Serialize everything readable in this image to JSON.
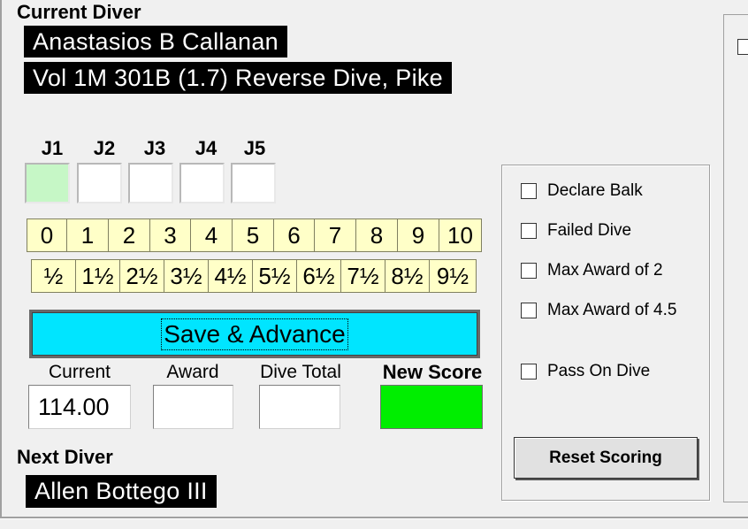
{
  "current_diver": {
    "label": "Current Diver",
    "name": "Anastasios B Callanan",
    "dive": "Vol 1M 301B (1.7) Reverse Dive, Pike"
  },
  "judges": {
    "labels": [
      "J1",
      "J2",
      "J3",
      "J4",
      "J5"
    ],
    "active_index": 0
  },
  "scores": {
    "whole": [
      "0",
      "1",
      "2",
      "3",
      "4",
      "5",
      "6",
      "7",
      "8",
      "9",
      "10"
    ],
    "half": [
      "½",
      "1½",
      "2½",
      "3½",
      "4½",
      "5½",
      "6½",
      "7½",
      "8½",
      "9½"
    ]
  },
  "save_button": {
    "label": "Save & Advance",
    "color": "#00e5ff"
  },
  "fields": {
    "current": {
      "label": "Current",
      "value": "114.00"
    },
    "award": {
      "label": "Award",
      "value": ""
    },
    "dive_total": {
      "label": "Dive Total",
      "value": ""
    },
    "new_score": {
      "label": "New Score",
      "value": "",
      "color": "#00ee00"
    }
  },
  "options": [
    {
      "label": "Declare Balk"
    },
    {
      "label": "Failed Dive"
    },
    {
      "label": "Max Award of 2"
    },
    {
      "label": "Max Award of 4.5"
    },
    {
      "label": "Pass On Dive"
    }
  ],
  "reset_button": {
    "label": "Reset Scoring"
  },
  "next_diver": {
    "label": "Next Diver",
    "name": "Allen Bottego III"
  }
}
